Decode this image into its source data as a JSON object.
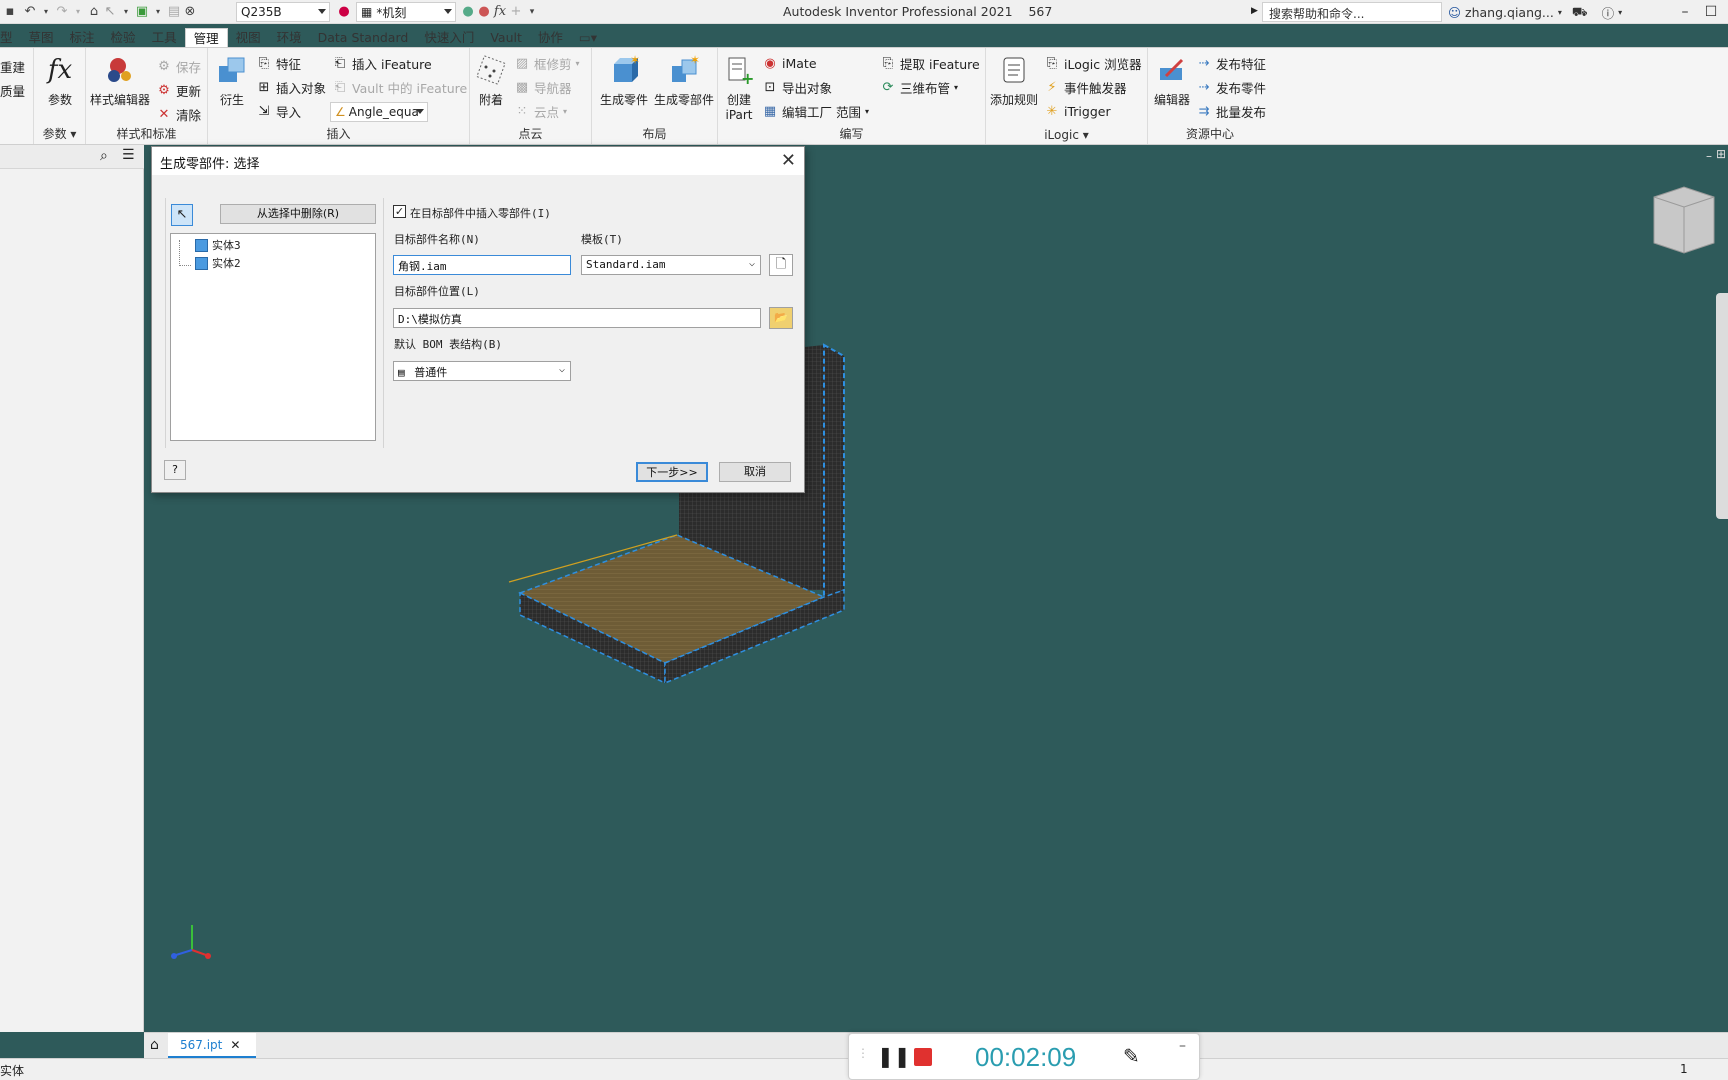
{
  "titlebar": {
    "material": "Q235B",
    "appearance": "*机刻",
    "app_title": "Autodesk Inventor Professional 2021",
    "doc_number": "567",
    "search_placeholder": "搜索帮助和命令...",
    "user": "zhang.qiang..."
  },
  "tabs": [
    "型",
    "草图",
    "标注",
    "检验",
    "工具",
    "管理",
    "视图",
    "环境",
    "Data Standard",
    "快速入门",
    "Vault",
    "协作"
  ],
  "active_tab": "管理",
  "ribbon": {
    "cut_left": [
      "重建",
      "质量"
    ],
    "params": {
      "big": "参数",
      "label": "参数"
    },
    "styles": {
      "big": "样式编辑器",
      "save": "保存",
      "update": "更新",
      "purge": "清除",
      "label": "样式和标准"
    },
    "insert": {
      "derive": "衍生",
      "feature": "特征",
      "insert_object": "插入对象",
      "import": "导入",
      "insert_ifeature": "插入 iFeature",
      "vault_ifeature": "Vault 中的 iFeature",
      "angle_combo": "Angle_equa",
      "label": "插入"
    },
    "pointcloud": {
      "attach": "附着",
      "trim_box": "框修剪",
      "navigator": "导航器",
      "cloud_point": "云点",
      "label": "点云"
    },
    "layout": {
      "make_part": "生成零件",
      "make_components": "生成零部件",
      "label": "布局"
    },
    "author": {
      "create_ipart": "创建",
      "create_ipart2": "iPart",
      "imate": "iMate",
      "export_object": "导出对象",
      "edit_factory": "编辑工厂 范围",
      "extract_ifeature": "提取 iFeature",
      "pipe": "三维布管",
      "label": "编写"
    },
    "ilogic": {
      "add_rule": "添加规则",
      "browser": "iLogic 浏览器",
      "event_trigger": "事件触发器",
      "itrigger": "iTrigger",
      "label": "iLogic"
    },
    "content": {
      "editor": "编辑器",
      "publish_feature": "发布特征",
      "publish_part": "发布零件",
      "batch_publish": "批量发布",
      "label": "资源中心"
    }
  },
  "dialog": {
    "title": "生成零部件: 选择",
    "remove_btn": "从选择中删除(R)",
    "tree": [
      "实体3",
      "实体2"
    ],
    "insert_checkbox": "在目标部件中插入零部件(I)",
    "target_name_label": "目标部件名称(N)",
    "target_name_value": "角钢.iam",
    "template_label": "模板(T)",
    "template_value": "Standard.iam",
    "location_label": "目标部件位置(L)",
    "location_value": "D:\\模拟仿真",
    "bom_label": "默认 BOM 表结构(B)",
    "bom_value": "普通件",
    "next_btn": "下一步>>",
    "cancel_btn": "取消",
    "help_btn": "?"
  },
  "doc_tab": "567.ipt",
  "status": {
    "left": "实体",
    "page": "1"
  },
  "recorder": {
    "time": "00:02:09"
  },
  "colors": {
    "viewport": "#2e5a5a",
    "accent": "#1e7fd0",
    "timer": "#2a9db0",
    "record": "#e0312f"
  }
}
